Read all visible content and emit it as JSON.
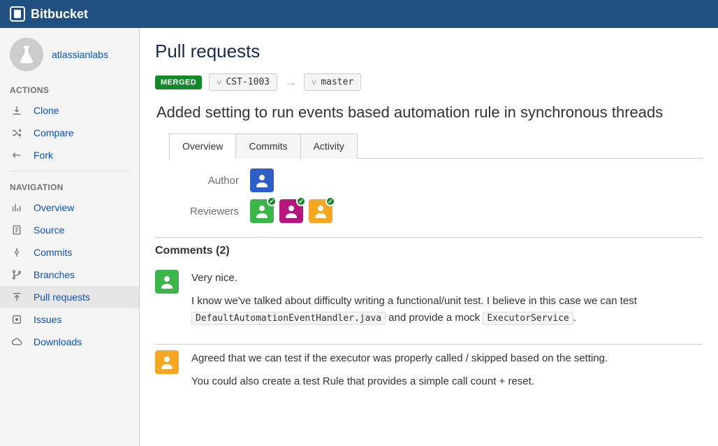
{
  "brand": "Bitbucket",
  "project": {
    "name": "atlassianlabs"
  },
  "sidebar": {
    "actions_heading": "ACTIONS",
    "navigation_heading": "NAVIGATION",
    "actions": [
      {
        "label": "Clone"
      },
      {
        "label": "Compare"
      },
      {
        "label": "Fork"
      }
    ],
    "navigation": [
      {
        "label": "Overview"
      },
      {
        "label": "Source"
      },
      {
        "label": "Commits"
      },
      {
        "label": "Branches"
      },
      {
        "label": "Pull requests"
      },
      {
        "label": "Issues"
      },
      {
        "label": "Downloads"
      }
    ]
  },
  "page": {
    "title": "Pull requests",
    "state_badge": "MERGED",
    "source_branch": "CST-1003",
    "target_branch": "master",
    "pr_title": "Added setting to run events based automation rule in synchronous threads",
    "tabs": {
      "overview": "Overview",
      "commits": "Commits",
      "activity": "Activity"
    },
    "author_label": "Author",
    "reviewers_label": "Reviewers",
    "author": {
      "color": "#2e5ec7"
    },
    "reviewers": [
      {
        "color": "#39b54a",
        "approved": true
      },
      {
        "color": "#b5177d",
        "approved": true
      },
      {
        "color": "#f5a623",
        "approved": true
      }
    ],
    "comments": {
      "heading": "Comments (2)",
      "items": [
        {
          "avatar_color": "#39b54a",
          "line1": "Very nice.",
          "line2_a": "I know we've talked about difficulty writing a functional/unit test. I believe in this case we can test ",
          "line2_code1": "DefaultAutomationEventHandler.java",
          "line2_b": " and provide a mock ",
          "line2_code2": "ExecutorService",
          "line2_c": "."
        },
        {
          "avatar_color": "#f5a623",
          "line1": "Agreed that we can test if the executor was properly called / skipped based on the setting.",
          "line2": "You could also create a test Rule that provides a simple call count + reset."
        }
      ]
    }
  }
}
